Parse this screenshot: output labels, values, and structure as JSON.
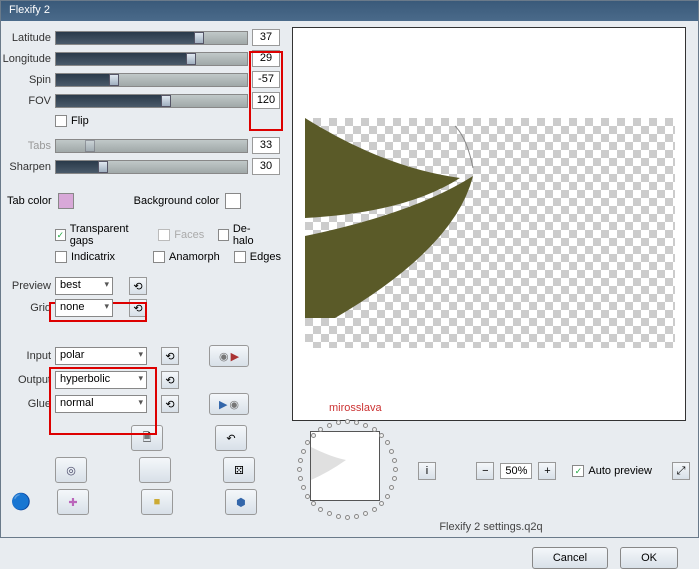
{
  "title": "Flexify 2",
  "sliders": {
    "latitude": {
      "label": "Latitude",
      "value": "37",
      "thumb_pct": 72
    },
    "longitude": {
      "label": "Longitude",
      "value": "29",
      "thumb_pct": 68
    },
    "spin": {
      "label": "Spin",
      "value": "-57",
      "thumb_pct": 28
    },
    "fov": {
      "label": "FOV",
      "value": "120",
      "thumb_pct": 55
    },
    "tabs": {
      "label": "Tabs",
      "value": "33",
      "thumb_pct": 15
    },
    "sharpen": {
      "label": "Sharpen",
      "value": "30",
      "thumb_pct": 22
    }
  },
  "checks": {
    "flip": {
      "label": "Flip",
      "on": false
    },
    "tgaps": {
      "label": "Transparent gaps",
      "on": true
    },
    "faces": {
      "label": "Faces",
      "on": false
    },
    "dehalo": {
      "label": "De-halo",
      "on": false
    },
    "indicatrix": {
      "label": "Indicatrix",
      "on": false
    },
    "anamorph": {
      "label": "Anamorph",
      "on": false
    },
    "edges": {
      "label": "Edges",
      "on": false
    },
    "autopreview": {
      "label": "Auto preview",
      "on": true
    }
  },
  "colors": {
    "tab_label": "Tab color",
    "tab_value": "#d8a8d8",
    "bg_label": "Background color",
    "bg_value": "#ffffff"
  },
  "selects": {
    "preview": {
      "label": "Preview",
      "value": "best"
    },
    "grid": {
      "label": "Grid",
      "value": "none"
    },
    "input": {
      "label": "Input",
      "value": "polar"
    },
    "output": {
      "label": "Output",
      "value": "hyperbolic"
    },
    "glue": {
      "label": "Glue",
      "value": "normal"
    }
  },
  "zoom": "50%",
  "settings_file": "Flexify 2 settings.q2q",
  "watermark": "mirosslava",
  "buttons": {
    "cancel": "Cancel",
    "ok": "OK"
  },
  "icons": {
    "sync": "⟲",
    "doc": "🗎",
    "undo": "↶",
    "target": "◎",
    "dice": "⚄",
    "globe": "🌐",
    "plus": "✚",
    "box": "■",
    "hex": "⬢",
    "play": "▶",
    "playpair": "▶▶",
    "info": "i",
    "minus": "−",
    "plusz": "+",
    "expand": "⤢"
  }
}
